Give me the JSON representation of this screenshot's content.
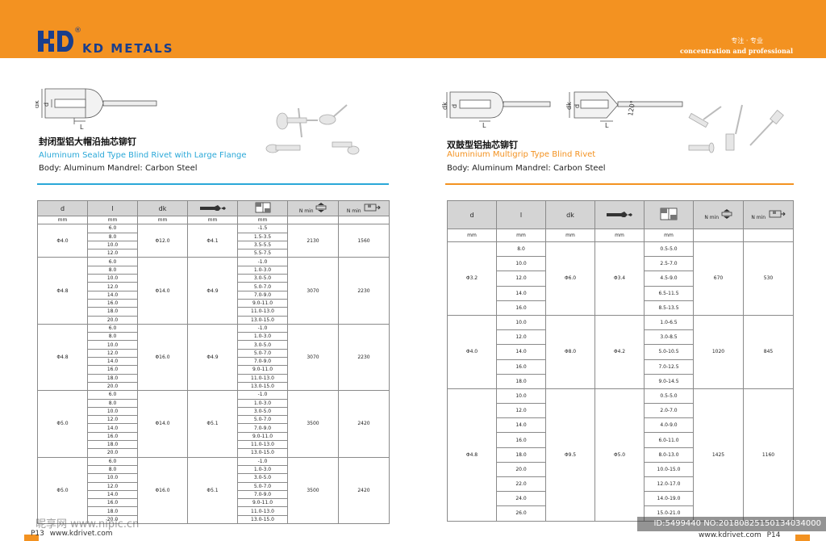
{
  "header": {
    "brand": "KD METALS",
    "registered": "®",
    "tagline_cn": "专注 · 专业",
    "tagline_en": "concentration and professional"
  },
  "colors": {
    "brand_orange": "#f39221",
    "brand_blue": "#1a3e8c",
    "left_accent": "#2aa8d8",
    "right_accent": "#f39221"
  },
  "left": {
    "title_cn": "封闭型铝大帽沿抽芯铆钉",
    "title_en": "Aluminum Seald Type Blind Rivet with Large Flange",
    "body": "Body: Aluminum   Mandrel: Carbon Steel",
    "drawing_labels": {
      "dk": "dk",
      "d": "d",
      "l": "L"
    },
    "columns": [
      "d",
      "l",
      "dk",
      "drill-icon",
      "grip-icon",
      "N min",
      "N min"
    ],
    "units": [
      "mm",
      "mm",
      "mm",
      "mm",
      "mm"
    ],
    "groups": [
      {
        "d": "Φ4.0",
        "dk": "Φ12.0",
        "hole": "Φ4.1",
        "shear": "2130",
        "tensile": "1560",
        "rows": [
          [
            "6.0",
            "-1.5"
          ],
          [
            "8.0",
            "1.5-3.5"
          ],
          [
            "10.0",
            "3.5-5.5"
          ],
          [
            "12.0",
            "5.5-7.5"
          ]
        ]
      },
      {
        "d": "Φ4.8",
        "dk": "Φ14.0",
        "hole": "Φ4.9",
        "shear": "3070",
        "tensile": "2230",
        "rows": [
          [
            "6.0",
            "-1.0"
          ],
          [
            "8.0",
            "1.0-3.0"
          ],
          [
            "10.0",
            "3.0-5.0"
          ],
          [
            "12.0",
            "5.0-7.0"
          ],
          [
            "14.0",
            "7.0-9.0"
          ],
          [
            "16.0",
            "9.0-11.0"
          ],
          [
            "18.0",
            "11.0-13.0"
          ],
          [
            "20.0",
            "13.0-15.0"
          ]
        ]
      },
      {
        "d": "Φ4.8",
        "dk": "Φ16.0",
        "hole": "Φ4.9",
        "shear": "3070",
        "tensile": "2230",
        "rows": [
          [
            "6.0",
            "-1.0"
          ],
          [
            "8.0",
            "1.0-3.0"
          ],
          [
            "10.0",
            "3.0-5.0"
          ],
          [
            "12.0",
            "5.0-7.0"
          ],
          [
            "14.0",
            "7.0-9.0"
          ],
          [
            "16.0",
            "9.0-11.0"
          ],
          [
            "18.0",
            "11.0-13.0"
          ],
          [
            "20.0",
            "13.0-15.0"
          ]
        ]
      },
      {
        "d": "Φ5.0",
        "dk": "Φ14.0",
        "hole": "Φ5.1",
        "shear": "3500",
        "tensile": "2420",
        "rows": [
          [
            "6.0",
            "-1.0"
          ],
          [
            "8.0",
            "1.0-3.0"
          ],
          [
            "10.0",
            "3.0-5.0"
          ],
          [
            "12.0",
            "5.0-7.0"
          ],
          [
            "14.0",
            "7.0-9.0"
          ],
          [
            "16.0",
            "9.0-11.0"
          ],
          [
            "18.0",
            "11.0-13.0"
          ],
          [
            "20.0",
            "13.0-15.0"
          ]
        ]
      },
      {
        "d": "Φ5.0",
        "dk": "Φ16.0",
        "hole": "Φ5.1",
        "shear": "3500",
        "tensile": "2420",
        "rows": [
          [
            "6.0",
            "-1.0"
          ],
          [
            "8.0",
            "1.0-3.0"
          ],
          [
            "10.0",
            "3.0-5.0"
          ],
          [
            "12.0",
            "5.0-7.0"
          ],
          [
            "14.0",
            "7.0-9.0"
          ],
          [
            "16.0",
            "9.0-11.0"
          ],
          [
            "18.0",
            "11.0-13.0"
          ],
          [
            "20.0",
            "13.0-15.0"
          ]
        ]
      }
    ]
  },
  "right": {
    "title_cn": "双鼓型铝抽芯铆钉",
    "title_en": "Aluminium Multigrip Type Blind  Rivet",
    "body": "Body: Aluminum    Mandrel: Carbon Steel",
    "drawing_labels": {
      "dk": "dk",
      "d": "d",
      "l": "L",
      "angle": "120°"
    },
    "columns": [
      "d",
      "l",
      "dk",
      "drill-icon",
      "grip-icon",
      "N min",
      "N min"
    ],
    "units": [
      "mm",
      "mm",
      "mm",
      "mm",
      "mm"
    ],
    "groups": [
      {
        "d": "Φ3.2",
        "dk": "Φ6.0",
        "hole": "Φ3.4",
        "shear": "670",
        "tensile": "530",
        "rows": [
          [
            "8.0",
            "0.5-5.0"
          ],
          [
            "10.0",
            "2.5-7.0"
          ],
          [
            "12.0",
            "4.5-9.0"
          ],
          [
            "14.0",
            "6.5-11.5"
          ],
          [
            "16.0",
            "8.5-13.5"
          ]
        ]
      },
      {
        "d": "Φ4.0",
        "dk": "Φ8.0",
        "hole": "Φ4.2",
        "shear": "1020",
        "tensile": "845",
        "rows": [
          [
            "10.0",
            "1.0-6.5"
          ],
          [
            "12.0",
            "3.0-8.5"
          ],
          [
            "14.0",
            "5.0-10.5"
          ],
          [
            "16.0",
            "7.0-12.5"
          ],
          [
            "18.0",
            "9.0-14.5"
          ]
        ]
      },
      {
        "d": "Φ4.8",
        "dk": "Φ9.5",
        "hole": "Φ5.0",
        "shear": "1425",
        "tensile": "1160",
        "rows": [
          [
            "10.0",
            "0.5-5.0"
          ],
          [
            "12.0",
            "2.0-7.0"
          ],
          [
            "14.0",
            "4.0-9.0"
          ],
          [
            "16.0",
            "6.0-11.0"
          ],
          [
            "18.0",
            "8.0-13.0"
          ],
          [
            "20.0",
            "10.0-15.0"
          ],
          [
            "22.0",
            "12.0-17.0"
          ],
          [
            "24.0",
            "14.0-19.0"
          ],
          [
            "26.0",
            "15.0-21.0"
          ]
        ]
      }
    ]
  },
  "footer": {
    "left_page": "P13",
    "left_url": "www.kdrivet.com",
    "right_url": "www.kdrivet.com",
    "right_page": "P14",
    "watermark_left": "昵享网 www.nipic.cn",
    "watermark_right": "ID:5499440 NO:20180825150134034000"
  }
}
